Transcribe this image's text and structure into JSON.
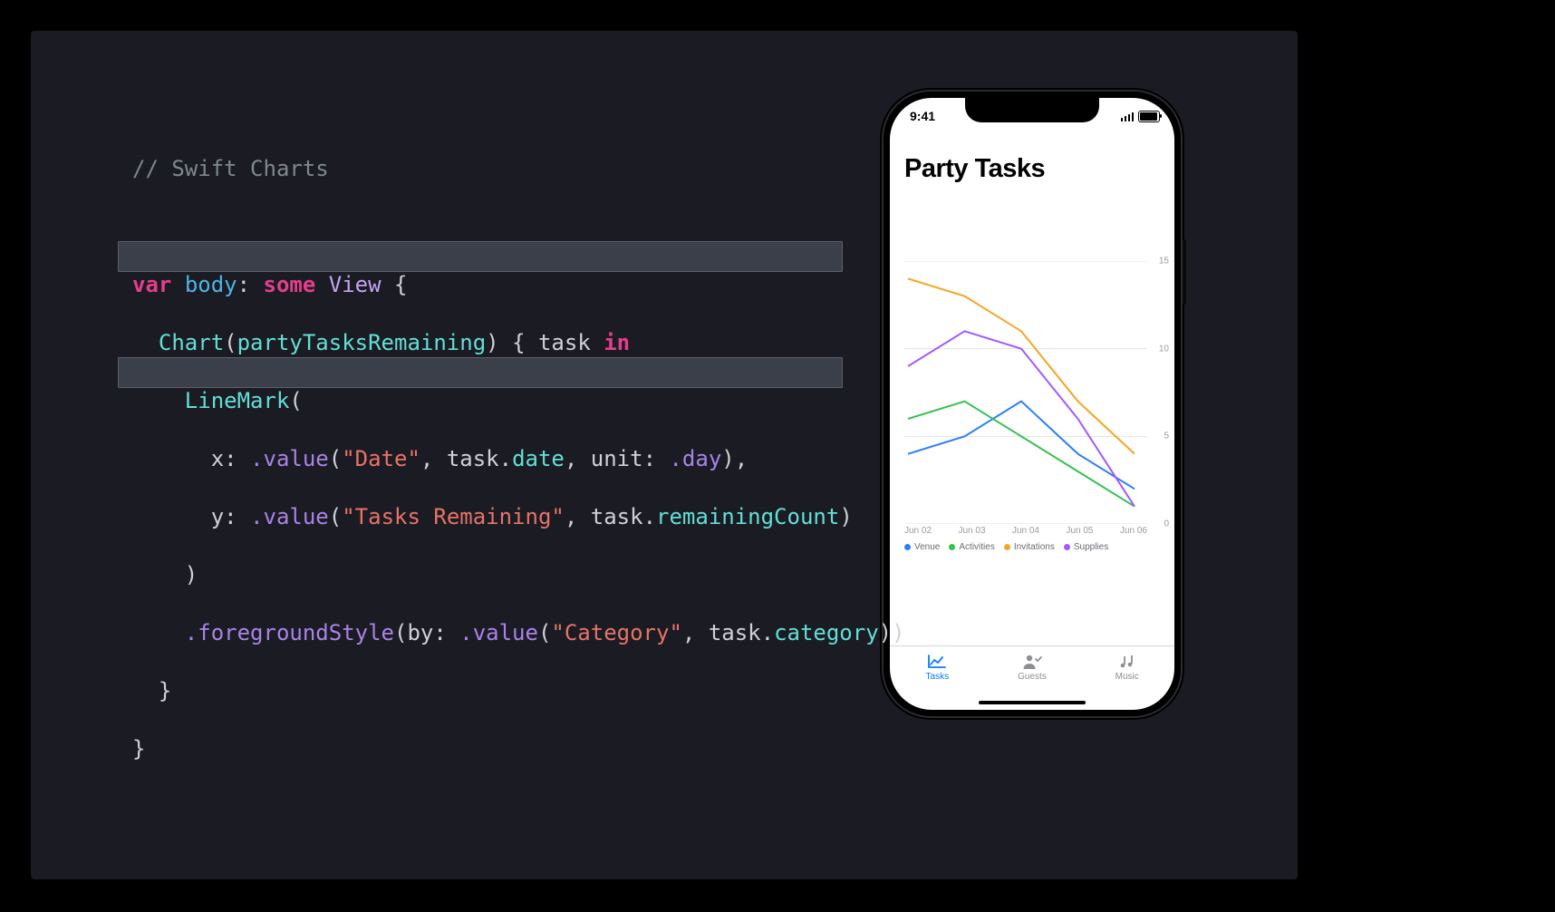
{
  "code": {
    "comment": "// Swift Charts",
    "l2": {
      "kw_var": "var",
      "ident_body": "body",
      "colon": ":",
      "kw_some": "some",
      "type_view": "View",
      "brace_open": "{"
    },
    "l3": {
      "call_chart": "Chart",
      "arg_party": "partyTasksRemaining",
      "brace_open_task": "{",
      "ident_task": "task",
      "kw_in": "in"
    },
    "l4": {
      "call_linemark": "LineMark",
      "paren_open": "("
    },
    "l5": {
      "arg_x": "x:",
      "method_value": ".value",
      "str_date": "\"Date\"",
      "comma1": ",",
      "task_date": "task.date",
      "comma2": ",",
      "arg_unit": "unit:",
      "enum_day": ".day",
      "paren_close_comma": "),"
    },
    "l6": {
      "arg_y": "y:",
      "method_value": ".value",
      "str_tasks": "\"Tasks Remaining\"",
      "comma": ",",
      "task_rc": "task.remainingCount",
      "paren_close": ")"
    },
    "l7": {
      "paren_close": ")"
    },
    "l8": {
      "method_fgs": ".foregroundStyle",
      "arg_by": "by:",
      "method_value": ".value",
      "str_cat": "\"Category\"",
      "comma": ",",
      "task_cat": "task.category",
      "paren_close2": "))"
    },
    "l9": {
      "brace_close": "}"
    },
    "l10": {
      "brace_close": "}"
    }
  },
  "phone": {
    "time": "9:41",
    "title": "Party Tasks",
    "tabs": {
      "tasks": "Tasks",
      "guests": "Guests",
      "music": "Music"
    },
    "legend": {
      "venue": "Venue",
      "activities": "Activities",
      "invitations": "Invitations",
      "supplies": "Supplies"
    },
    "x_ticks": [
      "Jun 02",
      "Jun 03",
      "Jun 04",
      "Jun 05",
      "Jun 06"
    ],
    "y_ticks": [
      "15",
      "10",
      "5",
      "0"
    ]
  },
  "colors": {
    "venue": "#2d7ff9",
    "activities": "#33c24d",
    "invitations": "#f5a623",
    "supplies": "#a259ff"
  },
  "chart_data": {
    "type": "line",
    "title": "Party Tasks",
    "xlabel": "",
    "ylabel": "",
    "categories": [
      "Jun 02",
      "Jun 03",
      "Jun 04",
      "Jun 05",
      "Jun 06"
    ],
    "ylim": [
      0,
      15
    ],
    "series": [
      {
        "name": "Venue",
        "color": "#2d7ff9",
        "values": [
          4,
          5,
          7,
          4,
          2
        ]
      },
      {
        "name": "Activities",
        "color": "#33c24d",
        "values": [
          6,
          7,
          5,
          3,
          1
        ]
      },
      {
        "name": "Invitations",
        "color": "#f5a623",
        "values": [
          14,
          13,
          11,
          7,
          4
        ]
      },
      {
        "name": "Supplies",
        "color": "#a259ff",
        "values": [
          9,
          11,
          10,
          6,
          1
        ]
      }
    ],
    "x_tick_labels": [
      "Jun 02",
      "Jun 03",
      "Jun 04",
      "Jun 05",
      "Jun 06"
    ],
    "y_tick_labels": [
      0,
      5,
      10,
      15
    ]
  }
}
